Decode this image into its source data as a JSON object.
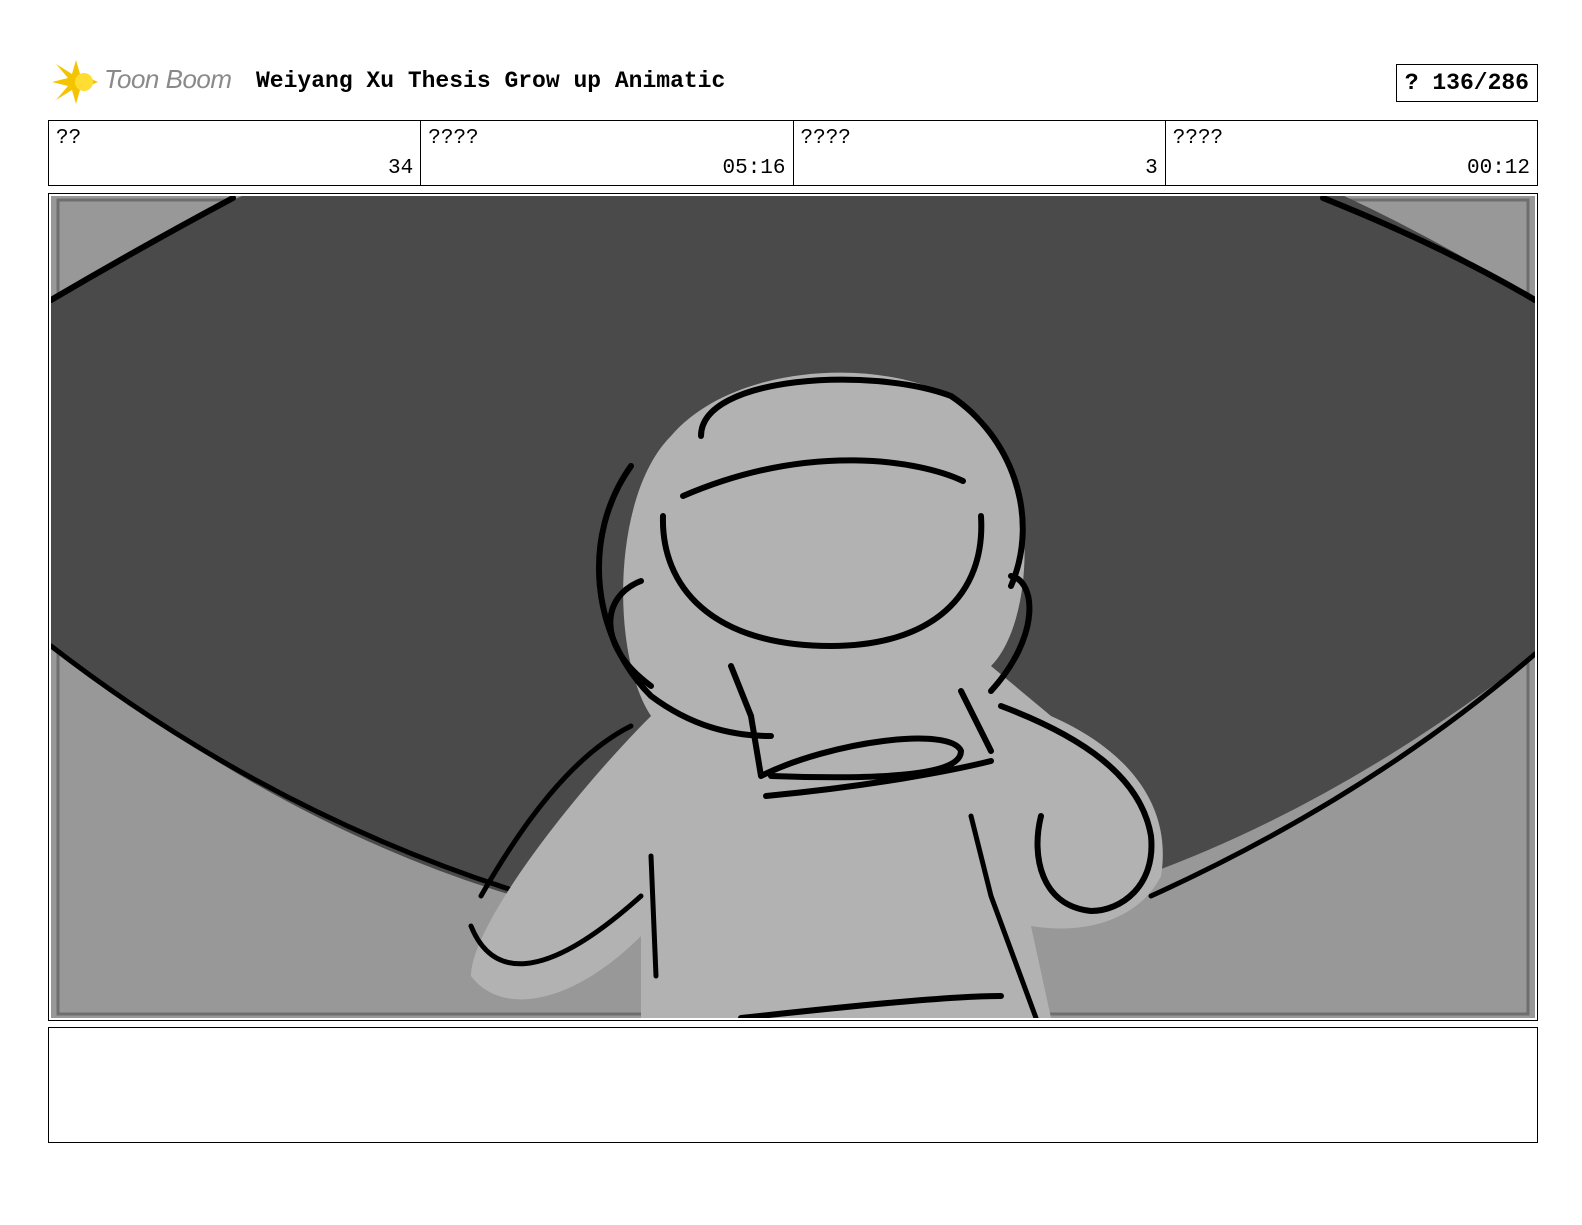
{
  "header": {
    "logo_text": "Toon Boom",
    "title": "Weiyang Xu Thesis Grow up Animatic",
    "page_counter": "? 136/286"
  },
  "info_bar": [
    {
      "label": "??",
      "value": "34"
    },
    {
      "label": "????",
      "value": "05:16"
    },
    {
      "label": "????",
      "value": "3"
    },
    {
      "label": "????",
      "value": "00:12"
    }
  ],
  "notes": {
    "text": ""
  },
  "colors": {
    "logo_accent": "#f5c400",
    "sketch_dark": "#4a4a4a",
    "sketch_mid": "#989898",
    "sketch_light": "#b2b2b2"
  }
}
